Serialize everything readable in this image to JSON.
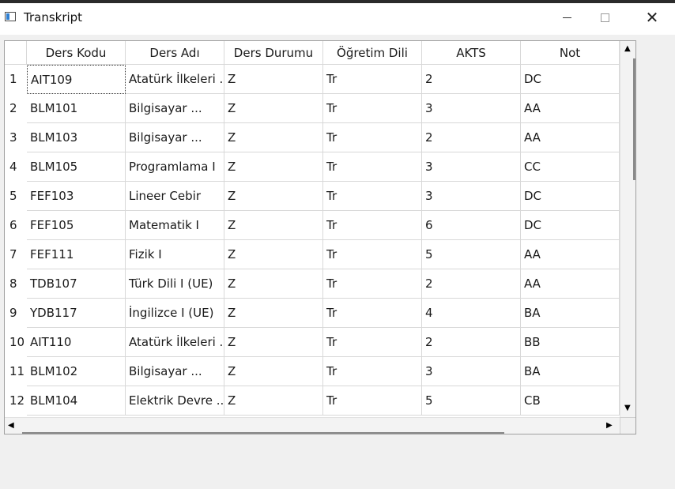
{
  "window": {
    "title": "Transkript"
  },
  "table": {
    "columns": [
      "Ders Kodu",
      "Ders Adı",
      "Ders Durumu",
      "Öğretim Dili",
      "AKTS",
      "Not"
    ],
    "rows": [
      {
        "num": "1",
        "cells": [
          "AIT109",
          "Atatürk İlkeleri ...",
          "Z",
          "Tr",
          "2",
          "DC"
        ]
      },
      {
        "num": "2",
        "cells": [
          "BLM101",
          "Bilgisayar ...",
          "Z",
          "Tr",
          "3",
          "AA"
        ]
      },
      {
        "num": "3",
        "cells": [
          "BLM103",
          "Bilgisayar ...",
          "Z",
          "Tr",
          "2",
          "AA"
        ]
      },
      {
        "num": "4",
        "cells": [
          "BLM105",
          "Programlama I",
          "Z",
          "Tr",
          "3",
          "CC"
        ]
      },
      {
        "num": "5",
        "cells": [
          "FEF103",
          "Lineer Cebir",
          "Z",
          "Tr",
          "3",
          "DC"
        ]
      },
      {
        "num": "6",
        "cells": [
          "FEF105",
          "Matematik I",
          "Z",
          "Tr",
          "6",
          "DC"
        ]
      },
      {
        "num": "7",
        "cells": [
          "FEF111",
          "Fizik I",
          "Z",
          "Tr",
          "5",
          "AA"
        ]
      },
      {
        "num": "8",
        "cells": [
          "TDB107",
          "Türk Dili I (UE)",
          "Z",
          "Tr",
          "2",
          "AA"
        ]
      },
      {
        "num": "9",
        "cells": [
          "YDB117",
          "İngilizce I (UE)",
          "Z",
          "Tr",
          "4",
          "BA"
        ]
      },
      {
        "num": "10",
        "cells": [
          "AIT110",
          "Atatürk İlkeleri ...",
          "Z",
          "Tr",
          "2",
          "BB"
        ]
      },
      {
        "num": "11",
        "cells": [
          "BLM102",
          "Bilgisayar ...",
          "Z",
          "Tr",
          "3",
          "BA"
        ]
      },
      {
        "num": "12",
        "cells": [
          "BLM104",
          "Elektrik Devre ...",
          "Z",
          "Tr",
          "5",
          "CB"
        ]
      }
    ]
  },
  "icons": {
    "app": "window-app-icon",
    "minimize": "minimize-icon",
    "maximize": "maximize-icon",
    "close": "close-icon",
    "scroll_up": "scroll-up-arrow-icon",
    "scroll_down": "scroll-down-arrow-icon",
    "scroll_left": "scroll-left-arrow-icon",
    "scroll_right": "scroll-right-arrow-icon"
  }
}
